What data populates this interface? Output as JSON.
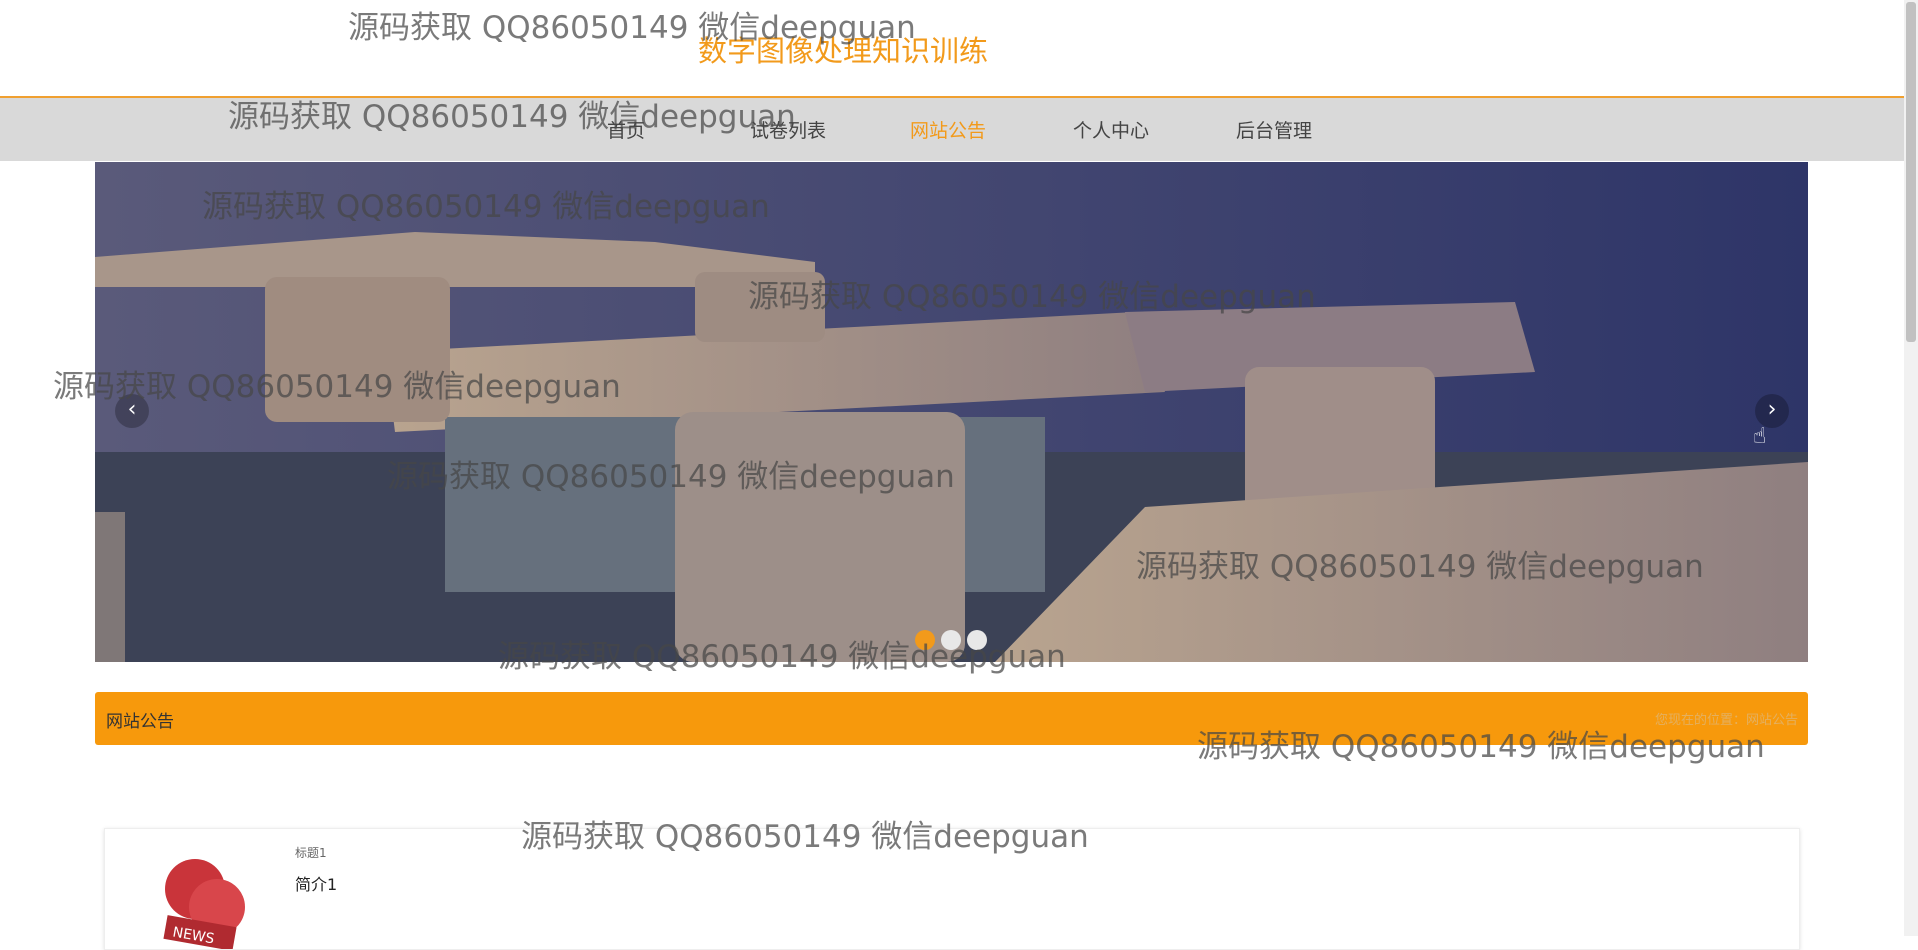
{
  "header": {
    "title": "数字图像处理知识训练"
  },
  "nav": {
    "items": [
      {
        "label": "首页"
      },
      {
        "label": "试卷列表"
      },
      {
        "label": "网站公告"
      },
      {
        "label": "个人中心"
      },
      {
        "label": "后台管理"
      }
    ],
    "active_index": 2
  },
  "carousel": {
    "prev_icon": "chevron-left-icon",
    "next_icon": "chevron-right-icon",
    "slide_count": 3,
    "active_slide": 1
  },
  "section": {
    "title": "网站公告",
    "breadcrumb": "您现在的位置：网站公告"
  },
  "news": [
    {
      "title": "标题1",
      "summary": "简介1",
      "thumb_text": "NEWS"
    }
  ],
  "watermark": {
    "text": "源码获取 QQ86050149 微信deepguan"
  },
  "colors": {
    "accent": "#f7990c",
    "nav_bg": "#d9d9d9"
  }
}
